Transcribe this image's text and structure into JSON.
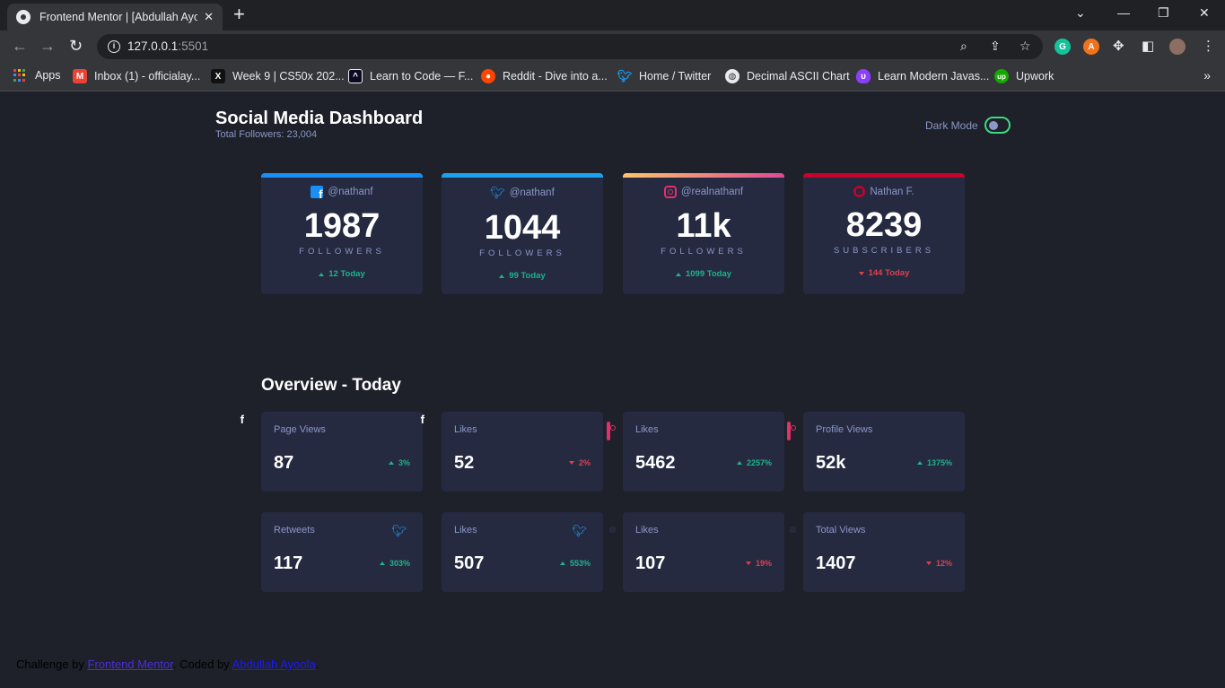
{
  "browser": {
    "tab_title": "Frontend Mentor | [Abdullah Ayo",
    "tab_close": "✕",
    "new_tab": "+",
    "url_host": "127.0.0.1",
    "url_port": ":5501",
    "bookmarks": [
      {
        "label": "Apps",
        "icon": "apps-grid-icon"
      },
      {
        "label": "Inbox (1) - officialay...",
        "icon": "gmail-icon",
        "color": "#ea4335"
      },
      {
        "label": "Week 9 | CS50x 202...",
        "icon": "x-icon",
        "color": "#111111"
      },
      {
        "label": "Learn to Code — F...",
        "icon": "fcc-icon",
        "color": "#0a0a23"
      },
      {
        "label": "Reddit - Dive into a...",
        "icon": "reddit-icon",
        "color": "#ff4500"
      },
      {
        "label": "Home / Twitter",
        "icon": "twitter-icon",
        "color": "#1d9bf0"
      },
      {
        "label": "Decimal ASCII Chart",
        "icon": "globe-icon",
        "color": "#9aa0a6"
      },
      {
        "label": "Learn Modern Javas...",
        "icon": "shield-icon",
        "color": "#8a3ffc"
      },
      {
        "label": "Upwork",
        "icon": "upwork-icon",
        "color": "#14a800"
      }
    ]
  },
  "dashboard": {
    "title": "Social Media Dashboard",
    "subtitle": "Total Followers: 23,004",
    "dark_mode_label": "Dark Mode",
    "dark_mode_on": true
  },
  "cards": [
    {
      "network": "facebook",
      "handle": "@nathanf",
      "count": "1987",
      "label": "FOLLOWERS",
      "change": "12 Today",
      "trend": "up",
      "color": "#198ff5"
    },
    {
      "network": "twitter",
      "handle": "@nathanf",
      "count": "1044",
      "label": "FOLLOWERS",
      "change": "99 Today",
      "trend": "up",
      "color": "#1ca0f2"
    },
    {
      "network": "instagram",
      "handle": "@realnathanf",
      "count": "11k",
      "label": "FOLLOWERS",
      "change": "1099 Today",
      "trend": "up",
      "color": "#df4996"
    },
    {
      "network": "youtube",
      "handle": "Nathan F.",
      "count": "8239",
      "label": "SUBSCRIBERS",
      "change": "144 Today",
      "trend": "down",
      "color": "#c4032a"
    }
  ],
  "overview": {
    "title": "Overview - Today",
    "items": [
      {
        "metric": "Page Views",
        "network": "facebook",
        "value": "87",
        "change": "3%",
        "trend": "up"
      },
      {
        "metric": "Likes",
        "network": "facebook",
        "value": "52",
        "change": "2%",
        "trend": "down"
      },
      {
        "metric": "Likes",
        "network": "instagram",
        "value": "5462",
        "change": "2257%",
        "trend": "up"
      },
      {
        "metric": "Profile Views",
        "network": "instagram",
        "value": "52k",
        "change": "1375%",
        "trend": "up"
      },
      {
        "metric": "Retweets",
        "network": "twitter",
        "value": "117",
        "change": "303%",
        "trend": "up"
      },
      {
        "metric": "Likes",
        "network": "twitter",
        "value": "507",
        "change": "553%",
        "trend": "up"
      },
      {
        "metric": "Likes",
        "network": "youtube",
        "value": "107",
        "change": "19%",
        "trend": "down"
      },
      {
        "metric": "Total Views",
        "network": "youtube",
        "value": "1407",
        "change": "12%",
        "trend": "down"
      }
    ]
  },
  "footer": {
    "prefix": "Challenge by ",
    "link1": "Frontend Mentor",
    "middle": ". Coded by ",
    "link2": "Abdullah Ayoola",
    "suffix": "."
  }
}
